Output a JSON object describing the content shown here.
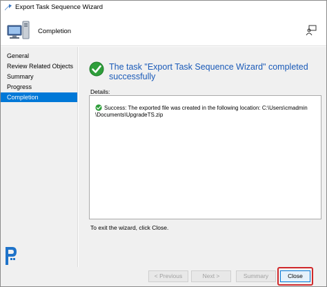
{
  "window": {
    "title": "Export Task Sequence Wizard"
  },
  "header": {
    "heading": "Completion"
  },
  "sidebar": {
    "items": [
      {
        "label": "General",
        "active": false
      },
      {
        "label": "Review Related Objects",
        "active": false
      },
      {
        "label": "Summary",
        "active": false
      },
      {
        "label": "Progress",
        "active": false
      },
      {
        "label": "Completion",
        "active": true
      }
    ]
  },
  "main": {
    "status_title": "The task \"Export Task Sequence Wizard\" completed successfully",
    "details_label": "Details:",
    "details_message": "Success: The exported file was created in the following location: C:\\Users\\cmadmin \\Documents\\UpgradeTS.zip",
    "exit_hint": "To exit the wizard, click Close."
  },
  "footer": {
    "previous_label": "< Previous",
    "next_label": "Next >",
    "summary_label": "Summary",
    "close_label": "Close"
  },
  "colors": {
    "accent": "#0078d7",
    "status_title": "#1a5ab8",
    "success_green": "#2e9e3a",
    "highlight_red": "#d0282a"
  },
  "icons": {
    "app": "wizard-arrow-icon",
    "header": "computer-icon",
    "help": "help-person-icon",
    "status": "check-circle-icon",
    "brand": "brand-logo-icon"
  }
}
